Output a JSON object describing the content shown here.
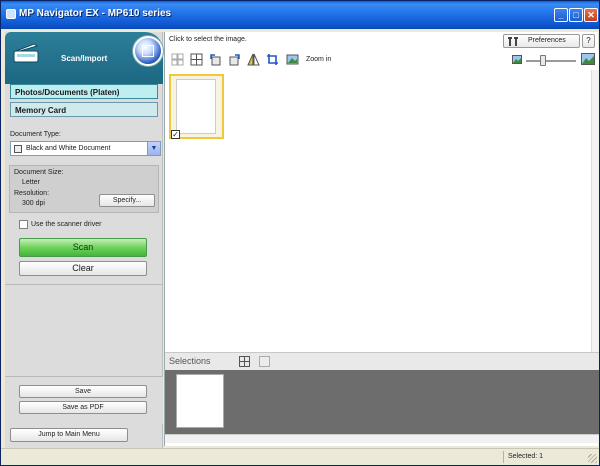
{
  "window": {
    "title": "MP Navigator EX - MP610 series",
    "minimize": "_",
    "maximize": "□",
    "close": "✕"
  },
  "left_panel": {
    "banner_label": "Scan/Import",
    "sources": [
      "Photos/Documents (Platen)",
      "Memory Card"
    ],
    "document_type_label": "Document Type:",
    "document_type_value": "Black and White Document",
    "document_size_label": "Document Size:",
    "document_size_value": "Letter",
    "resolution_label": "Resolution:",
    "resolution_value": "300 dpi",
    "specify_button": "Specify...",
    "scanner_driver_label": "Use the scanner driver",
    "scan_button": "Scan",
    "clear_button": "Clear",
    "save_button": "Save",
    "save_pdf_button": "Save as PDF",
    "jump_button": "Jump to Main Menu"
  },
  "right_panel": {
    "hint": "Click to select the image.",
    "preferences_button": "Preferences",
    "help_button": "?",
    "zoom_label": "Zoom in",
    "selections_label": "Selections"
  },
  "status": {
    "selected": "Selected: 1"
  },
  "colors": {
    "title_bar": "#1e6ee8",
    "banner": "#1e6a85",
    "scan_button": "#6ed25b",
    "selection_highlight": "#f0c83c"
  }
}
